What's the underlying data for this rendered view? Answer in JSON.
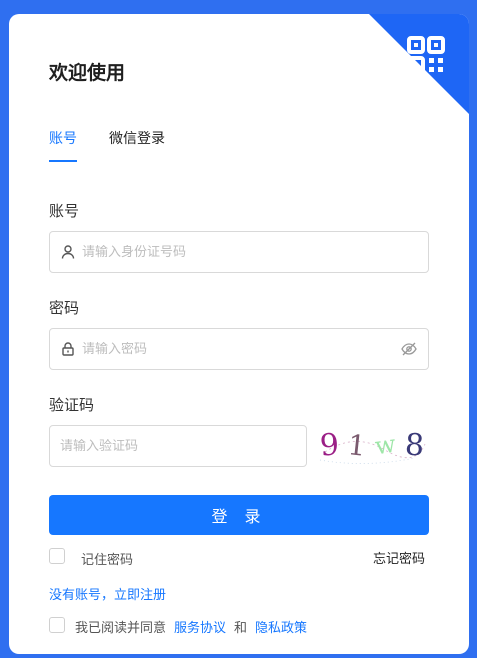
{
  "header": {
    "title": "欢迎使用"
  },
  "corner": {
    "icon": "qr-code-icon",
    "color": "#1e66f5"
  },
  "tabs": [
    {
      "label": "账号",
      "active": true
    },
    {
      "label": "微信登录",
      "active": false
    }
  ],
  "account": {
    "label": "账号",
    "placeholder": "请输入身份证号码",
    "value": ""
  },
  "password": {
    "label": "密码",
    "placeholder": "请输入密码",
    "value": ""
  },
  "captcha": {
    "label": "验证码",
    "placeholder": "请输入验证码",
    "value": "",
    "image_text": [
      "9",
      "1",
      "w",
      "8"
    ],
    "image_colors": [
      "#9b1f86",
      "#7a5a6e",
      "#9ee6a8",
      "#3a3a78"
    ]
  },
  "login": {
    "button_label": "登 录"
  },
  "remember": {
    "label": "记住密码",
    "checked": false
  },
  "forgot": {
    "label": "忘记密码"
  },
  "register": {
    "label": "没有账号，立即注册"
  },
  "agreement": {
    "prefix": "我已阅读并同意",
    "service_link": "服务协议",
    "conjunction": "和",
    "privacy_link": "隐私政策",
    "checked": false
  },
  "colors": {
    "accent": "#1677ff",
    "background": "#2f6ff0"
  }
}
